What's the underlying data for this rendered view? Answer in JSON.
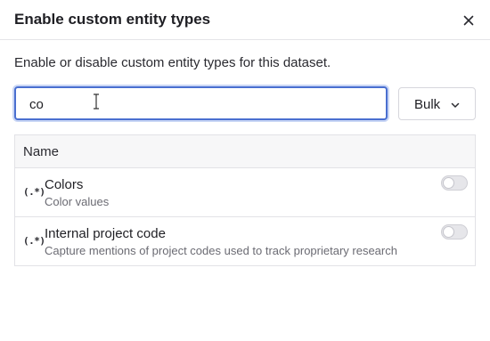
{
  "dialog": {
    "title": "Enable custom entity types",
    "description": "Enable or disable custom entity types for this dataset."
  },
  "search": {
    "value": "co",
    "placeholder": ""
  },
  "bulk": {
    "label": "Bulk"
  },
  "table": {
    "column_name": "Name",
    "rows": [
      {
        "icon": "(.*)",
        "name": "Colors",
        "description": "Color values",
        "enabled": false
      },
      {
        "icon": "(.*)",
        "name": "Internal project code",
        "description": "Capture mentions of project codes used to track proprietary research",
        "enabled": false
      }
    ]
  },
  "colors": {
    "focus_border": "#4a6fd0",
    "toggle_off": "#e6e6ea"
  }
}
